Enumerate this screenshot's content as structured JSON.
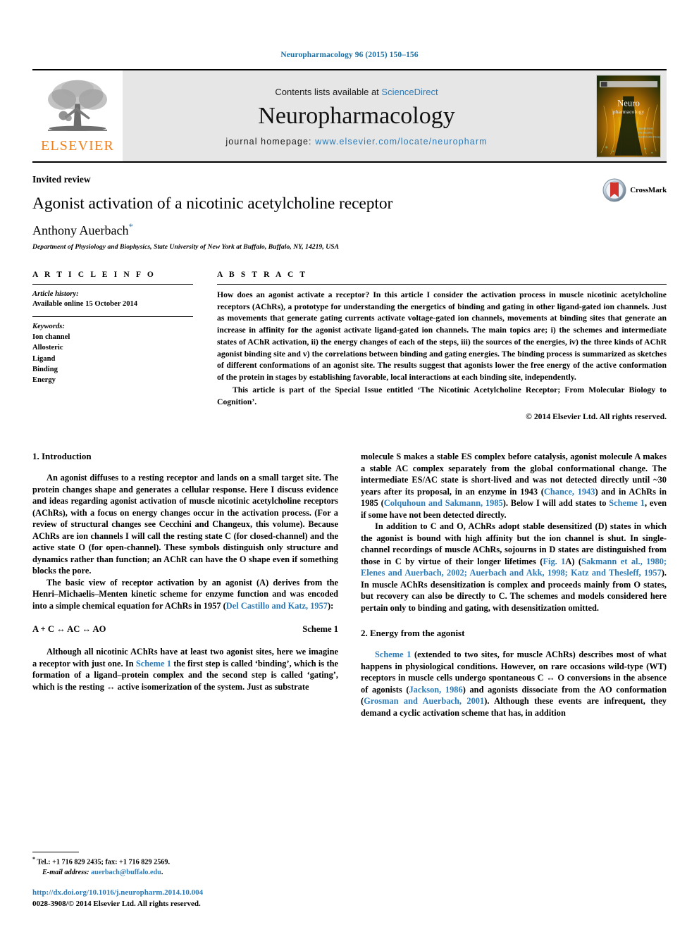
{
  "running_head": "Neuropharmacology 96 (2015) 150–156",
  "masthead": {
    "publisher_logo_text": "ELSEVIER",
    "publisher_logo_icon": "elsevier-tree-icon",
    "contents_prefix": "Contents lists available at ",
    "contents_link": "ScienceDirect",
    "journal_name": "Neuropharmacology",
    "homepage_prefix": "journal homepage: ",
    "homepage_url": "www.elsevier.com/locate/neuropharm",
    "cover_alt": "journal-cover-thumbnail"
  },
  "title_block": {
    "article_type": "Invited review",
    "title": "Agonist activation of a nicotinic acetylcholine receptor",
    "author": "Anthony Auerbach",
    "author_footnote_marker": "*",
    "affiliation": "Department of Physiology and Biophysics, State University of New York at Buffalo, Buffalo, NY, 14219, USA",
    "crossmark_label": "CrossMark"
  },
  "article_info": {
    "heading": "A R T I C L E  I N F O",
    "history_label": "Article history:",
    "history_value": "Available online 15 October 2014",
    "keywords_label": "Keywords:",
    "keywords": [
      "Ion channel",
      "Allosteric",
      "Ligand",
      "Binding",
      "Energy"
    ]
  },
  "abstract": {
    "heading": "A B S T R A C T",
    "paragraph_1": "How does an agonist activate a receptor? In this article I consider the activation process in muscle nicotinic acetylcholine receptors (AChRs), a prototype for understanding the energetics of binding and gating in other ligand-gated ion channels. Just as movements that generate gating currents activate voltage-gated ion channels, movements at binding sites that generate an increase in affinity for the agonist activate ligand-gated ion channels. The main topics are; i) the schemes and intermediate states of AChR activation, ii) the energy changes of each of the steps, iii) the sources of the energies, iv) the three kinds of AChR agonist binding site and v) the correlations between binding and gating energies. The binding process is summarized as sketches of different conformations of an agonist site. The results suggest that agonists lower the free energy of the active conformation of the protein in stages by establishing favorable, local interactions at each binding site, independently.",
    "paragraph_2": "This article is part of the Special Issue entitled ‘The Nicotinic Acetylcholine Receptor; From Molecular Biology to Cognition’.",
    "copyright": "© 2014 Elsevier Ltd. All rights reserved."
  },
  "body": {
    "section_1_title": "1.  Introduction",
    "section_2_title": "2.  Energy from the agonist",
    "left_p1_a": "An agonist diffuses to a resting receptor and lands on a small target site. The protein changes shape and generates a cellular response. Here I discuss evidence and ideas regarding agonist activation of muscle nicotinic acetylcholine receptors (AChRs), with a focus on energy changes occur in the activation process. (For a review of structural changes see Cecchini and Changeux, this volume). Because AChRs are ion channels I will call the resting state C (for closed-channel) and the active state O (for open-channel). These symbols distinguish only structure and dynamics rather than function; an AChR can have the O shape even if something blocks the pore.",
    "left_p2_a": "The basic view of receptor activation by an agonist (A) derives from the Henri–Michaelis–Menten kinetic scheme for enzyme function and was encoded into a simple chemical equation for AChRs in 1957 (",
    "left_p2_ref": "Del Castillo and Katz, 1957",
    "left_p2_b": "):",
    "scheme_equation": "A + C ↔ AC ↔ AO",
    "scheme_label": "Scheme 1",
    "left_p3_a": "Although all nicotinic AChRs have at least two agonist sites, here we imagine a receptor with just one. In ",
    "left_p3_ref": "Scheme 1",
    "left_p3_b": " the first step is called ‘binding’, which is the formation of a ligand–protein complex and the second step is called ‘gating’, which is the resting ↔ active isomerization of the system. Just as substrate",
    "right_p1_a": "molecule S makes a stable ES complex before catalysis, agonist molecule A makes a stable AC complex separately from the global conformational change. The intermediate ES/AC state is short-lived and was not detected directly until ~30 years after its proposal, in an enzyme in 1943 (",
    "right_p1_ref1": "Chance, 1943",
    "right_p1_b": ") and in AChRs in 1985 (",
    "right_p1_ref2": "Colquhoun and Sakmann, 1985",
    "right_p1_c": "). Below I will add states to ",
    "right_p1_ref3": "Scheme 1",
    "right_p1_d": ", even if some have not been detected directly.",
    "right_p2_a": "In addition to C and O, AChRs adopt stable desensitized (D) states in which the agonist is bound with high affinity but the ion channel is shut. In single-channel recordings of muscle AChRs, sojourns in D states are distinguished from those in C by virtue of their longer lifetimes (",
    "right_p2_ref1": "Fig. 1",
    "right_p2_b": "A) (",
    "right_p2_ref2": "Sakmann et al., 1980; Elenes and Auerbach, 2002; Auerbach and Akk, 1998; Katz and Thesleff, 1957",
    "right_p2_c": "). In muscle AChRs desensitization is complex and proceeds mainly from O states, but recovery can also be directly to C. The schemes and models considered here pertain only to binding and gating, with desensitization omitted.",
    "right_p3_ref1": "Scheme 1",
    "right_p3_a": " (extended to two sites, for muscle AChRs) describes most of what happens in physiological conditions. However, on rare occasions wild-type (WT) receptors in muscle cells undergo spontaneous C ↔ O conversions in the absence of agonists (",
    "right_p3_ref2": "Jackson, 1986",
    "right_p3_b": ") and agonists dissociate from the AO conformation (",
    "right_p3_ref3": "Grosman and Auerbach, 2001",
    "right_p3_c": "). Although these events are infrequent, they demand a cyclic activation scheme that has, in addition"
  },
  "footnote": {
    "marker": "*",
    "tel_fax": "Tel.: +1 716 829 2435; fax: +1 716 829 2569.",
    "email_label": "E-mail address:",
    "email": "auerbach@buffalo.edu",
    "email_suffix": ".",
    "doi": "http://dx.doi.org/10.1016/j.neuropharm.2014.10.004",
    "issn_line": "0028-3908/© 2014 Elsevier Ltd. All rights reserved."
  },
  "colors": {
    "link_blue": "#2b7bb9",
    "running_head_blue": "#1a72a8",
    "elsevier_orange": "#f08019",
    "masthead_gray": "#e6e6e6"
  }
}
